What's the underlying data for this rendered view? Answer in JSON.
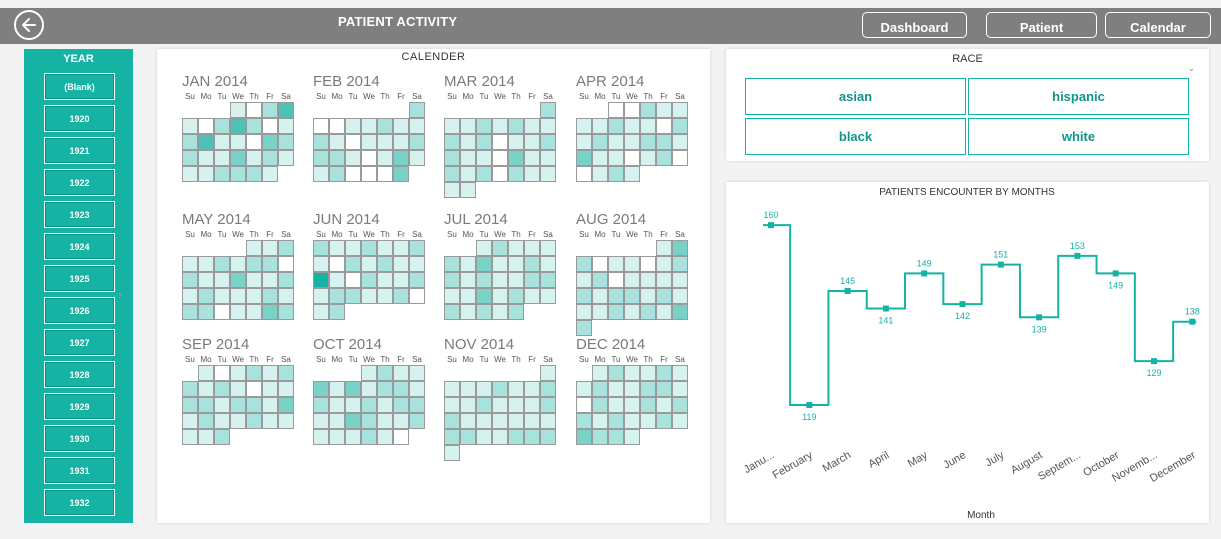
{
  "header": {
    "title": "PATIENT ACTIVITY",
    "nav": [
      "Dashboard",
      "Patient",
      "Calendar"
    ]
  },
  "year_slicer": {
    "title": "YEAR",
    "items": [
      "(Blank)",
      "1920",
      "1921",
      "1922",
      "1923",
      "1924",
      "1925",
      "1926",
      "1927",
      "1928",
      "1929",
      "1930",
      "1931",
      "1932"
    ]
  },
  "calendar": {
    "title": "CALENDER",
    "weekdays": [
      "Su",
      "Mo",
      "Tu",
      "We",
      "Th",
      "Fr",
      "Sa"
    ],
    "months": [
      {
        "label": "JAN 2014",
        "first_weekday": 3,
        "days": 31,
        "levels": [
          1,
          0,
          2,
          4,
          1,
          0,
          2,
          4,
          2,
          0,
          1,
          2,
          4,
          1,
          1,
          0,
          3,
          2,
          2,
          1,
          1,
          3,
          1,
          2,
          1,
          1,
          1,
          2,
          2,
          2,
          1
        ]
      },
      {
        "label": "FEB 2014",
        "first_weekday": 6,
        "days": 28,
        "levels": [
          2,
          0,
          0,
          1,
          1,
          2,
          1,
          1,
          2,
          1,
          0,
          1,
          1,
          1,
          2,
          2,
          2,
          1,
          0,
          1,
          3,
          1,
          1,
          2,
          0,
          0,
          0,
          3
        ]
      },
      {
        "label": "MAR 2014",
        "first_weekday": 6,
        "days": 31,
        "levels": [
          2,
          1,
          1,
          2,
          1,
          2,
          1,
          1,
          2,
          1,
          2,
          0,
          1,
          1,
          2,
          2,
          1,
          1,
          0,
          3,
          1,
          1,
          2,
          1,
          2,
          0,
          2,
          1,
          1,
          1,
          1
        ]
      },
      {
        "label": "APR 2014",
        "first_weekday": 2,
        "days": 30,
        "levels": [
          0,
          0,
          2,
          1,
          1,
          1,
          1,
          2,
          1,
          1,
          0,
          2,
          1,
          2,
          1,
          1,
          2,
          2,
          1,
          3,
          1,
          1,
          0,
          1,
          2,
          0,
          0,
          1,
          2,
          1
        ]
      },
      {
        "label": "MAY 2014",
        "first_weekday": 4,
        "days": 31,
        "levels": [
          1,
          1,
          2,
          1,
          1,
          2,
          1,
          2,
          2,
          0,
          2,
          1,
          1,
          3,
          1,
          1,
          2,
          1,
          2,
          1,
          1,
          1,
          2,
          1,
          2,
          2,
          0,
          1,
          1,
          3,
          2
        ]
      },
      {
        "label": "JUN 2014",
        "first_weekday": 0,
        "days": 30,
        "levels": [
          2,
          1,
          1,
          2,
          1,
          1,
          2,
          1,
          0,
          2,
          1,
          2,
          1,
          1,
          5,
          1,
          0,
          2,
          1,
          1,
          2,
          1,
          2,
          2,
          1,
          1,
          2,
          0,
          1,
          2
        ]
      },
      {
        "label": "JUL 2014",
        "first_weekday": 2,
        "days": 31,
        "levels": [
          1,
          2,
          1,
          1,
          1,
          2,
          1,
          3,
          1,
          1,
          2,
          1,
          2,
          1,
          2,
          1,
          1,
          2,
          2,
          1,
          1,
          3,
          1,
          2,
          1,
          1,
          2,
          1,
          2,
          1,
          2
        ]
      },
      {
        "label": "AUG 2014",
        "first_weekday": 5,
        "days": 31,
        "levels": [
          1,
          3,
          2,
          0,
          1,
          1,
          0,
          1,
          2,
          1,
          2,
          0,
          1,
          1,
          1,
          1,
          2,
          1,
          2,
          2,
          1,
          2,
          1,
          1,
          1,
          2,
          1,
          2,
          1,
          3,
          2
        ]
      },
      {
        "label": "SEP 2014",
        "first_weekday": 1,
        "days": 30,
        "levels": [
          1,
          0,
          1,
          2,
          1,
          2,
          2,
          1,
          2,
          1,
          0,
          1,
          1,
          2,
          2,
          1,
          2,
          2,
          1,
          3,
          1,
          2,
          1,
          1,
          2,
          1,
          1,
          1,
          1,
          2
        ]
      },
      {
        "label": "OCT 2014",
        "first_weekday": 3,
        "days": 31,
        "levels": [
          1,
          2,
          1,
          1,
          3,
          1,
          3,
          1,
          2,
          2,
          1,
          2,
          1,
          1,
          2,
          1,
          2,
          2,
          1,
          1,
          3,
          2,
          1,
          1,
          2,
          1,
          1,
          1,
          2,
          1,
          0
        ]
      },
      {
        "label": "NOV 2014",
        "first_weekday": 6,
        "days": 30,
        "levels": [
          1,
          1,
          1,
          1,
          2,
          1,
          1,
          2,
          1,
          1,
          2,
          1,
          1,
          1,
          2,
          2,
          1,
          1,
          1,
          1,
          1,
          1,
          2,
          2,
          1,
          1,
          2,
          2,
          2,
          1
        ]
      },
      {
        "label": "DEC 2014",
        "first_weekday": 1,
        "days": 31,
        "levels": [
          1,
          2,
          1,
          1,
          2,
          1,
          1,
          2,
          1,
          1,
          2,
          2,
          1,
          0,
          2,
          1,
          1,
          2,
          1,
          2,
          2,
          1,
          2,
          1,
          1,
          2,
          1,
          3,
          2,
          2,
          1
        ]
      }
    ],
    "colors": [
      "#ffffff",
      "#d6f2ee",
      "#a8e2dc",
      "#78d2c8",
      "#4cc3b6",
      "#14b3a4"
    ]
  },
  "race_slicer": {
    "title": "RACE",
    "items": [
      "asian",
      "hispanic",
      "black",
      "white"
    ]
  },
  "chart_data": {
    "type": "line",
    "title": "PATIENTS ENCOUNTER BY MONTHS",
    "xlabel": "Month",
    "ylabel": "",
    "categories": [
      "Janu...",
      "February",
      "March",
      "April",
      "May",
      "June",
      "July",
      "August",
      "Septem...",
      "October",
      "Novemb...",
      "December"
    ],
    "series": [
      {
        "values": [
          160,
          119,
          145,
          141,
          149,
          142,
          151,
          139,
          153,
          149,
          129,
          138
        ]
      }
    ],
    "line_shape": "step",
    "ylim": [
      114,
      163
    ],
    "color": "#14b3a4"
  }
}
